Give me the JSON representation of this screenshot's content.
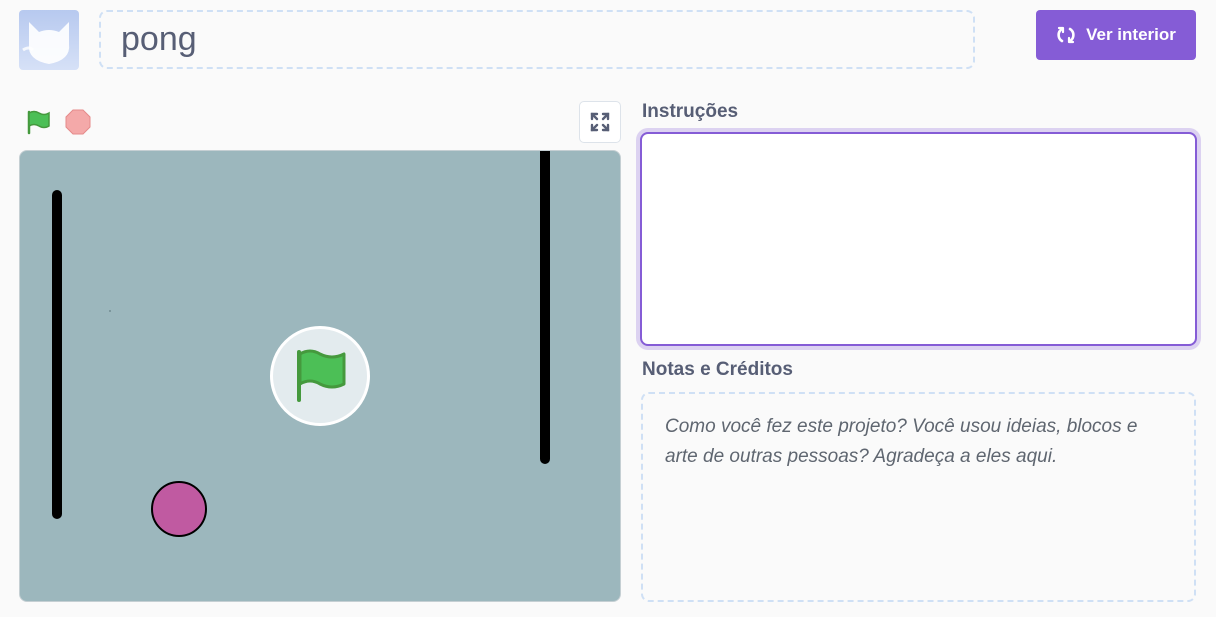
{
  "project": {
    "title": "pong"
  },
  "header": {
    "see_inside_label": "Ver interior",
    "accent_color": "#855cd6"
  },
  "controls": {
    "green_flag_icon": "green-flag-icon",
    "stop_icon": "stop-icon",
    "fullscreen_icon": "fullscreen-icon"
  },
  "stage": {
    "background_color": "#9cb7bd",
    "sprites": [
      "paddle-left",
      "paddle-right",
      "ball"
    ],
    "ball_color": "#c05aa1"
  },
  "instructions": {
    "label": "Instruções",
    "value": ""
  },
  "notes": {
    "label": "Notas e Créditos",
    "placeholder": "Como você fez este projeto? Você usou ideias, blocos e arte de outras pessoas? Agradeça a eles aqui."
  }
}
